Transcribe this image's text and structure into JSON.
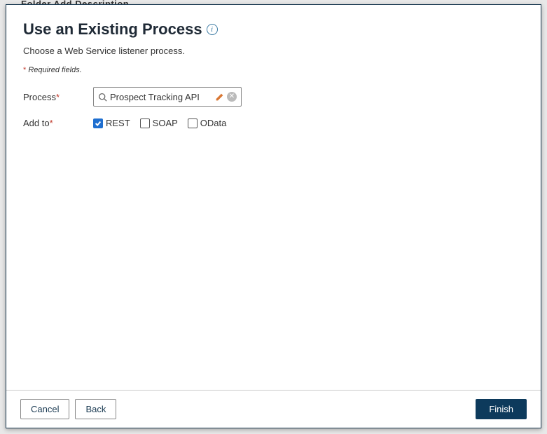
{
  "backdrop": {
    "text": "Folder    Add Description"
  },
  "modal": {
    "title": "Use an Existing Process",
    "subtitle": "Choose a Web Service listener process.",
    "required_note_asterisk": "*",
    "required_note": " Required fields.",
    "form": {
      "process": {
        "label": "Process",
        "required_marker": "*",
        "value": "Prospect Tracking API"
      },
      "add_to": {
        "label": "Add to",
        "required_marker": "*",
        "options": [
          {
            "label": "REST",
            "checked": true
          },
          {
            "label": "SOAP",
            "checked": false
          },
          {
            "label": "OData",
            "checked": false
          }
        ]
      }
    },
    "footer": {
      "cancel": "Cancel",
      "back": "Back",
      "finish": "Finish"
    }
  }
}
